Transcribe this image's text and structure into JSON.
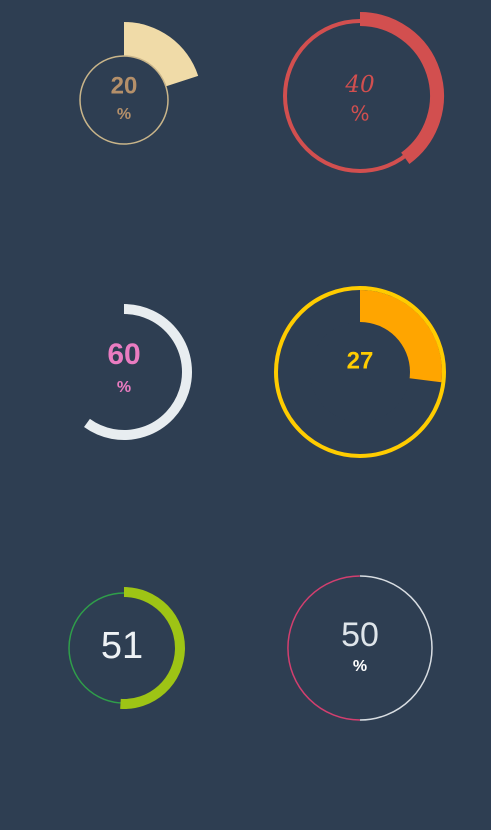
{
  "chart_data": [
    {
      "type": "pie",
      "value": 20,
      "label": "20",
      "suffix": "%",
      "colors": {
        "fill": "#f0dba8",
        "ring": "#c9b58a",
        "text": "#b5906a"
      }
    },
    {
      "type": "pie",
      "value": 40,
      "label": "40",
      "suffix": "%",
      "colors": {
        "arc": "#d24f4f",
        "text": "#d24f4f"
      }
    },
    {
      "type": "pie",
      "value": 60,
      "label": "60",
      "suffix": "%",
      "colors": {
        "arc": "#e8edf0",
        "text": "#ea7cc1"
      }
    },
    {
      "type": "pie",
      "value": 27,
      "label": "27",
      "suffix": "",
      "colors": {
        "ring": "#ffcc00",
        "fill": "#ffa500",
        "text": "#ffcc00"
      }
    },
    {
      "type": "pie",
      "value": 51,
      "label": "51",
      "suffix": "",
      "colors": {
        "arc": "#9ec415",
        "ring": "#2f9e4a",
        "text": "#eef2f5"
      }
    },
    {
      "type": "pie",
      "value": 50,
      "label": "50",
      "suffix": "%",
      "colors": {
        "arc": "#d8dde2",
        "rest": "#d23f6f",
        "text": "#dfe5ea"
      }
    }
  ]
}
